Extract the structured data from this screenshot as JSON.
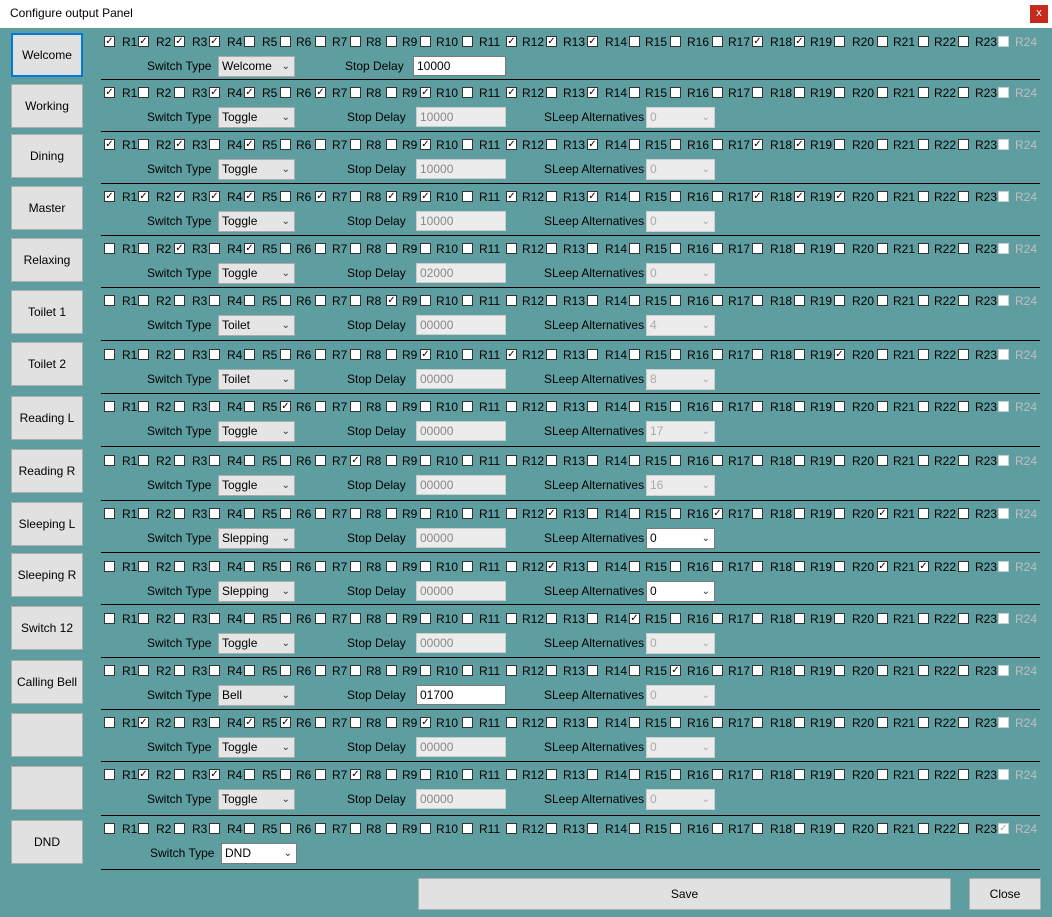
{
  "window": {
    "title": "Configure output Panel",
    "close_glyph": "x"
  },
  "labels": {
    "switch_type": "Switch Type",
    "stop_delay": "Stop Delay",
    "sleep_alt": "SLeep Alternatives",
    "relays": [
      "R1",
      "R2",
      "R3",
      "R4",
      "R5",
      "R6",
      "R7",
      "R8",
      "R9",
      "R10",
      "R11",
      "R12",
      "R13",
      "R14",
      "R15",
      "R16",
      "R17",
      "R18",
      "R19",
      "R20",
      "R21",
      "R22",
      "R23",
      "R24"
    ]
  },
  "rows": [
    {
      "name": "Welcome",
      "checked": [
        1,
        2,
        3,
        4,
        12,
        13,
        14,
        18,
        19
      ],
      "switch_type": "Welcome",
      "stop_delay": "10000",
      "sleep_alt": null,
      "r24_checked": false
    },
    {
      "name": "Working",
      "checked": [
        1,
        4,
        5,
        7,
        10,
        12,
        14
      ],
      "switch_type": "Toggle",
      "stop_delay": "10000",
      "sleep_alt": "0",
      "r24_checked": false
    },
    {
      "name": "Dining",
      "checked": [
        1,
        3,
        5,
        10,
        12,
        14,
        18,
        19
      ],
      "switch_type": "Toggle",
      "stop_delay": "10000",
      "sleep_alt": "0",
      "r24_checked": false
    },
    {
      "name": "Master",
      "checked": [
        1,
        2,
        3,
        4,
        5,
        7,
        9,
        10,
        12,
        14,
        18,
        19,
        20
      ],
      "switch_type": "Toggle",
      "stop_delay": "10000",
      "sleep_alt": "0",
      "r24_checked": false
    },
    {
      "name": "Relaxing",
      "checked": [
        3,
        5
      ],
      "switch_type": "Toggle",
      "stop_delay": "02000",
      "sleep_alt": "0",
      "r24_checked": false
    },
    {
      "name": "Toilet 1",
      "checked": [
        9
      ],
      "switch_type": "Toilet",
      "stop_delay": "00000",
      "sleep_alt": "4",
      "r24_checked": false
    },
    {
      "name": "Toilet 2",
      "checked": [
        10,
        12,
        20
      ],
      "switch_type": "Toilet",
      "stop_delay": "00000",
      "sleep_alt": "8",
      "r24_checked": false
    },
    {
      "name": "Reading L",
      "checked": [
        6
      ],
      "switch_type": "Toggle",
      "stop_delay": "00000",
      "sleep_alt": "17",
      "r24_checked": false
    },
    {
      "name": "Reading R",
      "checked": [
        8
      ],
      "switch_type": "Toggle",
      "stop_delay": "00000",
      "sleep_alt": "16",
      "r24_checked": false
    },
    {
      "name": "Sleeping L",
      "checked": [
        13,
        17,
        21
      ],
      "switch_type": "Slepping",
      "stop_delay": "00000",
      "sleep_alt": "0",
      "r24_checked": false
    },
    {
      "name": "Sleeping R",
      "checked": [
        13,
        21,
        22
      ],
      "switch_type": "Slepping",
      "stop_delay": "00000",
      "sleep_alt": "0",
      "r24_checked": false
    },
    {
      "name": "Switch 12",
      "checked": [
        15
      ],
      "switch_type": "Toggle",
      "stop_delay": "00000",
      "sleep_alt": "0",
      "r24_checked": false
    },
    {
      "name": "Calling Bell",
      "checked": [
        16
      ],
      "switch_type": "Bell",
      "stop_delay": "01700",
      "sleep_alt": "0",
      "r24_checked": false
    },
    {
      "name": "",
      "checked": [
        2,
        5,
        6,
        10
      ],
      "switch_type": "Toggle",
      "stop_delay": "00000",
      "sleep_alt": "0",
      "r24_checked": false
    },
    {
      "name": "",
      "checked": [
        2,
        4,
        8
      ],
      "switch_type": "Toggle",
      "stop_delay": "00000",
      "sleep_alt": "0",
      "r24_checked": false
    },
    {
      "name": "DND",
      "checked": [],
      "switch_type": "DND",
      "stop_delay": null,
      "sleep_alt": null,
      "r24_checked": true
    }
  ],
  "buttons": {
    "save": "Save",
    "close": "Close"
  }
}
